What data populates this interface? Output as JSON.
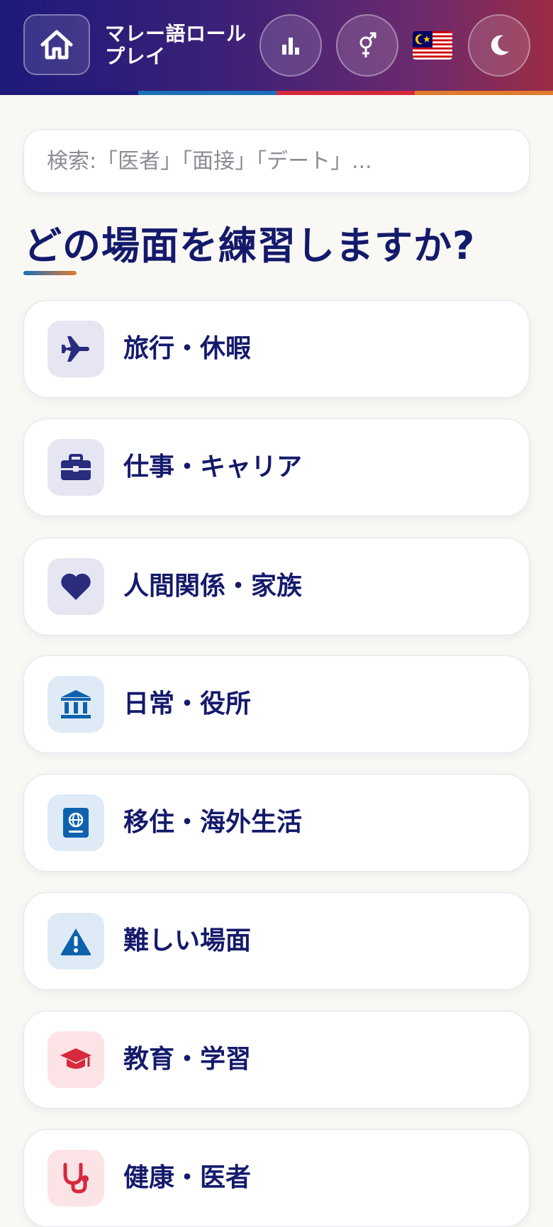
{
  "header": {
    "app_title": "マレー語ロールプレイ",
    "home_icon": "home-icon",
    "stats_icon": "bar-chart-icon",
    "gender_icon": "gender-icon",
    "language_flag": "malaysia-flag",
    "theme_icon": "moon-icon",
    "stripe_colors": [
      "#1d1a7a",
      "#1a6fb8",
      "#d42a3c",
      "#e07a2c"
    ]
  },
  "search": {
    "placeholder": "検索:「医者」「面接」「デート」..."
  },
  "page_title": "どの場面を練習しますか?",
  "categories": [
    {
      "label": "旅行・休暇",
      "icon": "airplane-icon",
      "icon_color": "#2a2c7e",
      "icon_bg": "#e6e6f2"
    },
    {
      "label": "仕事・キャリア",
      "icon": "briefcase-icon",
      "icon_color": "#2a2c7e",
      "icon_bg": "#e6e6f2"
    },
    {
      "label": "人間関係・家族",
      "icon": "heart-icon",
      "icon_color": "#2a2c7e",
      "icon_bg": "#e6e6f2"
    },
    {
      "label": "日常・役所",
      "icon": "government-building-icon",
      "icon_color": "#0e62ad",
      "icon_bg": "#deebf6"
    },
    {
      "label": "移住・海外生活",
      "icon": "passport-icon",
      "icon_color": "#0e62ad",
      "icon_bg": "#deebf6"
    },
    {
      "label": "難しい場面",
      "icon": "warning-icon",
      "icon_color": "#0e62ad",
      "icon_bg": "#deebf6"
    },
    {
      "label": "教育・学習",
      "icon": "graduation-cap-icon",
      "icon_color": "#d42a3c",
      "icon_bg": "#fbe3e6"
    },
    {
      "label": "健康・医者",
      "icon": "stethoscope-icon",
      "icon_color": "#d42a3c",
      "icon_bg": "#fbe3e6"
    }
  ]
}
